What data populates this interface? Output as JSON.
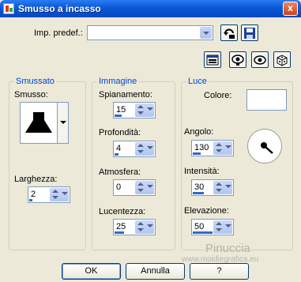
{
  "window": {
    "title": "Smusso a incasso",
    "close_label": "x"
  },
  "preset": {
    "label": "Imp. predef.:",
    "value": ""
  },
  "groups": {
    "smussato": {
      "legend": "Smussato",
      "smusso_label": "Smusso:",
      "larghezza_label": "Larghezza:",
      "larghezza_value": "2"
    },
    "immagine": {
      "legend": "Immagine",
      "fields": [
        {
          "label": "Spianamento:",
          "value": "15"
        },
        {
          "label": "Profondità:",
          "value": "4"
        },
        {
          "label": "Atmosfera:",
          "value": "0"
        },
        {
          "label": "Lucentezza:",
          "value": "25"
        }
      ]
    },
    "luce": {
      "legend": "Luce",
      "colore_label": "Colore:",
      "colore_value": "#ffffff",
      "fields": [
        {
          "label": "Angolo:",
          "value": "130"
        },
        {
          "label": "Intensità:",
          "value": "30"
        },
        {
          "label": "Elevazione:",
          "value": "50"
        }
      ]
    }
  },
  "buttons": {
    "ok": "OK",
    "cancel": "Annulla",
    "help": "?"
  },
  "watermark": {
    "name": "Pinuccia",
    "site": "www.moidiegrafica.eu"
  },
  "colors": {
    "titlebar": "#0a57d6",
    "accent": "#0046d5",
    "face": "#ece9d8"
  },
  "icons": [
    "save-preset-icon",
    "save-icon",
    "preview-toggle-icon",
    "proof-icon",
    "eye-icon",
    "randomize-dice-icon",
    "bevel-shape-icon",
    "light-direction-icon"
  ]
}
